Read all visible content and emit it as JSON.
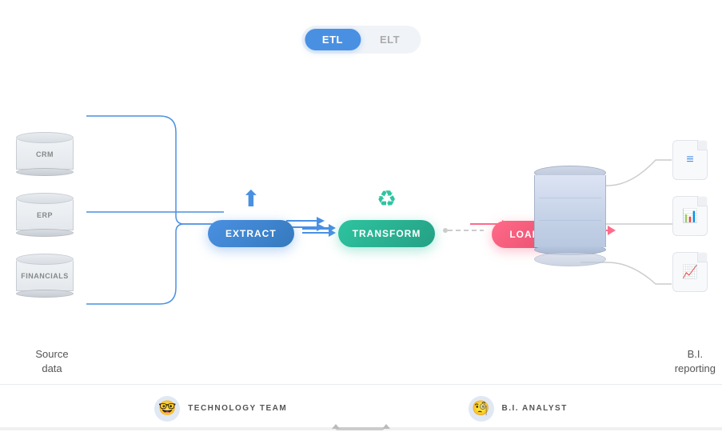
{
  "toggle": {
    "etl_label": "ETL",
    "elt_label": "ELT",
    "active": "ETL"
  },
  "source": {
    "databases": [
      {
        "label": "CRM"
      },
      {
        "label": "ERP"
      },
      {
        "label": "FINANCIALS"
      }
    ],
    "caption_line1": "Source",
    "caption_line2": "data"
  },
  "extract": {
    "label": "EXTRACT"
  },
  "transform": {
    "label": "TRANSFORM"
  },
  "load": {
    "label": "LOAD"
  },
  "bi": {
    "caption_line1": "B.I.",
    "caption_line2": "reporting"
  },
  "footer": {
    "technology_team_label": "TECHNOLOGY",
    "technology_team_suffix": " TEAM",
    "bi_analyst_label": "B.I. ANALYST"
  },
  "colors": {
    "extract": "#4a90e2",
    "transform": "#2ec4a0",
    "load": "#ff6b8a",
    "arrow_blue": "#4a90e2",
    "arrow_pink": "#ff6b8a"
  }
}
